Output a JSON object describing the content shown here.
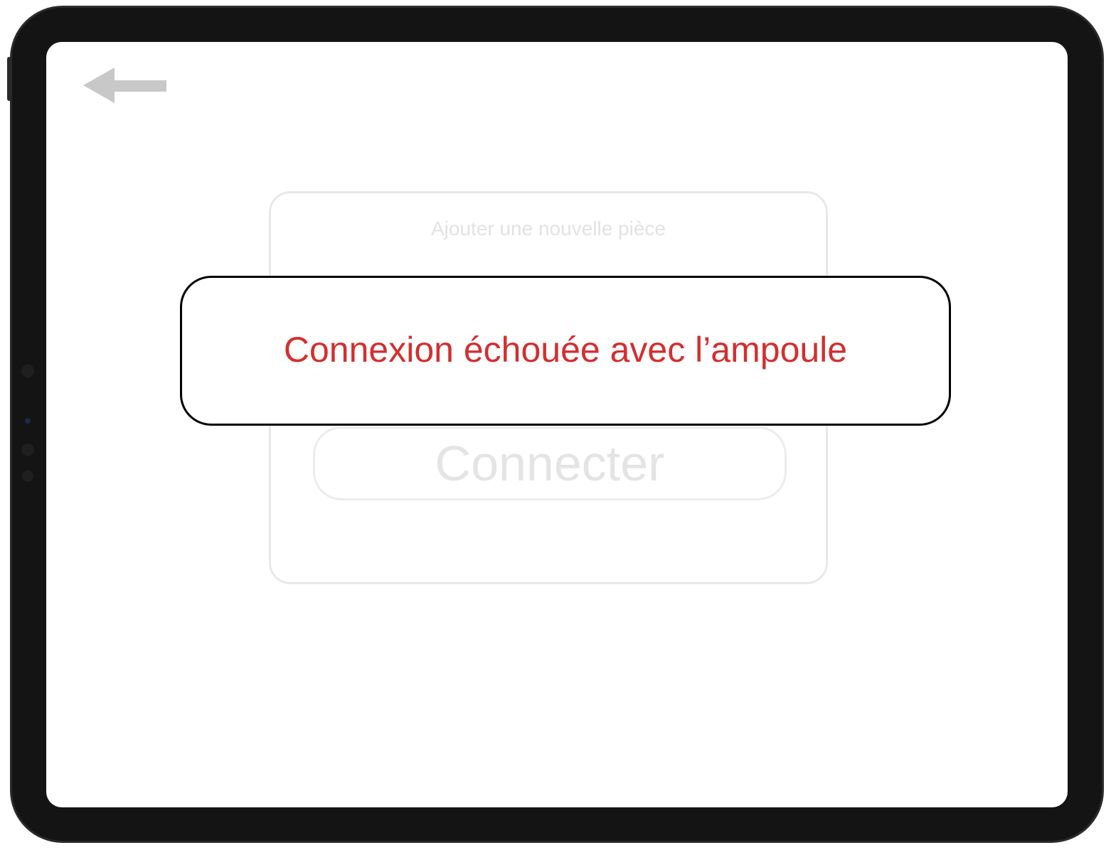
{
  "screen": {
    "back_icon": "arrow-left-icon"
  },
  "room_card": {
    "title": "Ajouter une nouvelle pièce",
    "connect_button_label": "Connecter"
  },
  "error_dialog": {
    "message": "Connexion échouée avec l’ampoule"
  },
  "colors": {
    "error": "#d32f2f",
    "frame": "#141414",
    "disabled_text": "#e4e4e4",
    "back_arrow": "#c8c8c8"
  }
}
